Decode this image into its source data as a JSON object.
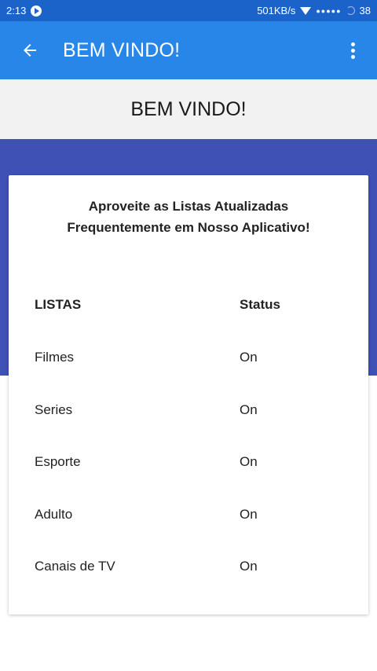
{
  "status_bar": {
    "time": "2:13",
    "network_speed": "501KB/s",
    "battery": "38",
    "icons": [
      "play-icon",
      "wifi-icon",
      "signal-icon",
      "battery-icon"
    ]
  },
  "app_bar": {
    "title": "BEM VINDO!",
    "back_icon": "arrow-left-icon",
    "menu_icon": "more-vertical-icon",
    "color": "#2786e8"
  },
  "header": {
    "title": "BEM VINDO!"
  },
  "card": {
    "intro_line1": "Aproveite as Listas Atualizadas",
    "intro_line2": "Frequentemente em Nosso Aplicativo!",
    "columns": {
      "list": "LISTAS",
      "status": "Status"
    },
    "rows": [
      {
        "name": "Filmes",
        "status": "On"
      },
      {
        "name": "Series",
        "status": "On"
      },
      {
        "name": "Esporte",
        "status": "On"
      },
      {
        "name": "Adulto",
        "status": "On"
      },
      {
        "name": "Canais de TV",
        "status": "On"
      }
    ]
  },
  "colors": {
    "status_bar": "#1b63c9",
    "band": "#3f51b5",
    "header_bg": "#f2f2f2"
  }
}
